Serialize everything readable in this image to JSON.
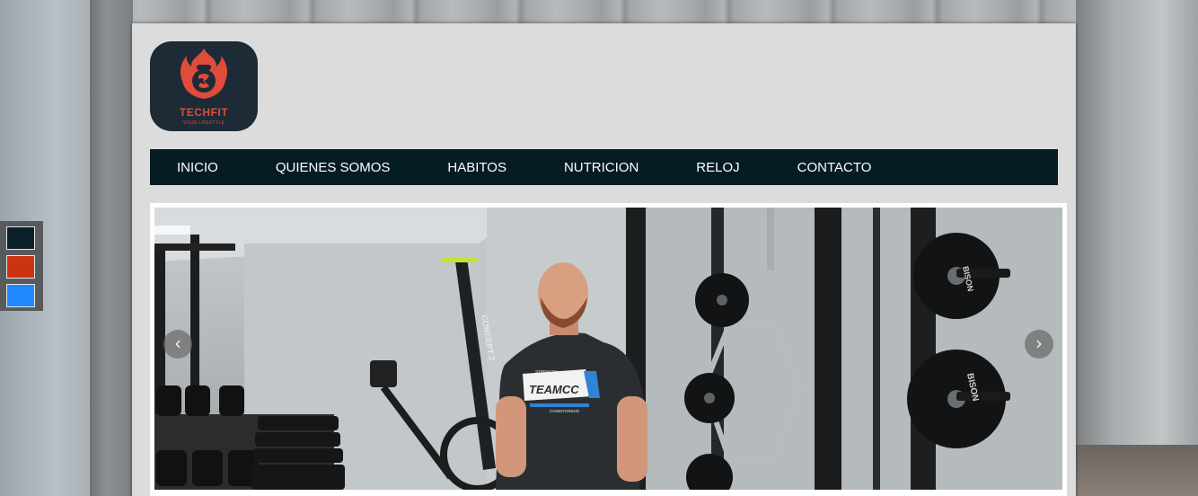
{
  "brand": {
    "name": "TECHFIT",
    "tagline": "YOUR LIFESTYLE",
    "logo_bg": "#1c2b36",
    "accent": "#e04b3a"
  },
  "nav": {
    "items": [
      {
        "label": "INICIO"
      },
      {
        "label": "QUIENES SOMOS"
      },
      {
        "label": "HABITOS"
      },
      {
        "label": "NUTRICION"
      },
      {
        "label": "RELOJ"
      },
      {
        "label": "CONTACTO"
      }
    ],
    "bg": "#061c25"
  },
  "slider": {
    "prev_icon": "chevron-left-icon",
    "next_icon": "chevron-right-icon",
    "prev_glyph": "‹",
    "next_glyph": "›",
    "shirt_text": "TEAMCC",
    "shirt_small_top": "STRENGTH",
    "shirt_small_bottom": "CONDITIONING",
    "plate_text": "BISON",
    "machine_text": "CONCEPT 2"
  },
  "theme_swatches": [
    "#0b1f29",
    "#cc3311",
    "#2288ff"
  ]
}
